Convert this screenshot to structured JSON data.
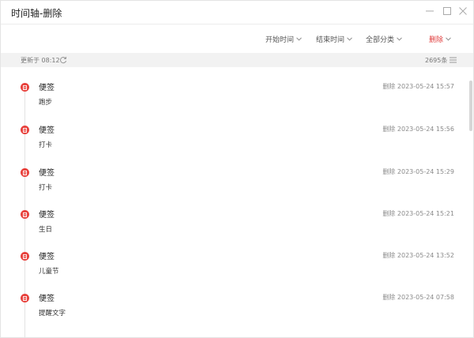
{
  "window": {
    "title": "时间轴-删除"
  },
  "filters": {
    "start_time": "开始时间",
    "end_time": "结束时间",
    "category": "全部分类",
    "status": "删除"
  },
  "status": {
    "updated": "更新于 08:12",
    "count": "2695条"
  },
  "colors": {
    "accent": "#e8413c",
    "status_text": "#e03c3c"
  },
  "entries": [
    {
      "title": "便签",
      "content": "跑步",
      "meta": "删除 2023-05-24 15:57"
    },
    {
      "title": "便签",
      "content": "打卡",
      "meta": "删除 2023-05-24 15:56"
    },
    {
      "title": "便签",
      "content": "打卡",
      "meta": "删除 2023-05-24 15:29"
    },
    {
      "title": "便签",
      "content": "生日",
      "meta": "删除 2023-05-24 15:21"
    },
    {
      "title": "便签",
      "content": "儿童节",
      "meta": "删除 2023-05-24 13:52"
    },
    {
      "title": "便签",
      "content": "提醒文字",
      "meta": "删除 2023-05-24 07:58"
    }
  ]
}
